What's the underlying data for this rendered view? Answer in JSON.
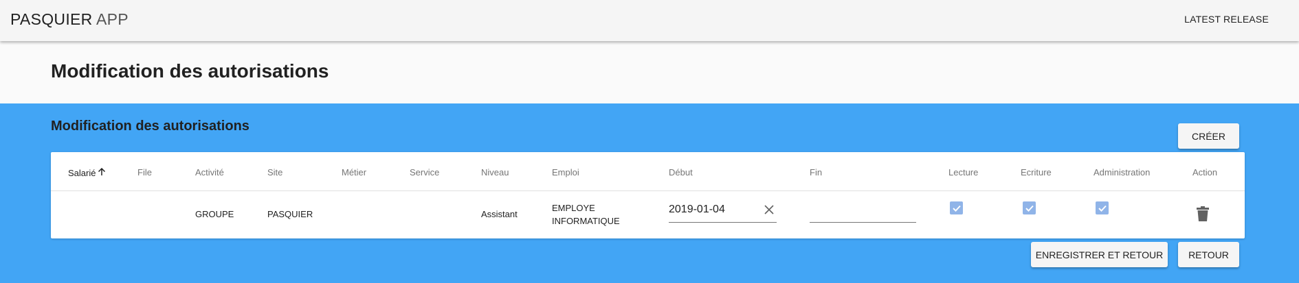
{
  "app": {
    "brand_bold": "PASQUIER",
    "brand_light": "APP",
    "latest_release": "LATEST RELEASE"
  },
  "page": {
    "title": "Modification des autorisations"
  },
  "section": {
    "title": "Modification des autorisations",
    "create_button": "CRÉER",
    "save_back_button": "ENREGISTRER ET RETOUR",
    "back_button": "RETOUR"
  },
  "table": {
    "columns": [
      "Salarié",
      "File",
      "Activité",
      "Site",
      "Métier",
      "Service",
      "Niveau",
      "Emploi",
      "Début",
      "Fin",
      "Lecture",
      "Ecriture",
      "Administration",
      "Action"
    ],
    "sorted_column": "Salarié",
    "sort_direction": "ascending",
    "rows": [
      {
        "salarie": "",
        "file": "",
        "activite": "GROUPE",
        "site": "PASQUIER",
        "metier": "",
        "service": "",
        "niveau": "Assistant",
        "emploi_line1": "EMPLOYE",
        "emploi_line2": "INFORMATIQUE",
        "debut": "2019-01-04",
        "fin": "",
        "lecture": true,
        "ecriture": true,
        "administration": true
      }
    ]
  },
  "colors": {
    "appbar": "#f5f5f5",
    "section_bg": "#42a5f5",
    "checkbox": "#90b4e8"
  },
  "icons": {
    "sort": "arrow-up-icon",
    "clear": "close-icon",
    "delete": "trash-icon",
    "check": "check-icon"
  }
}
